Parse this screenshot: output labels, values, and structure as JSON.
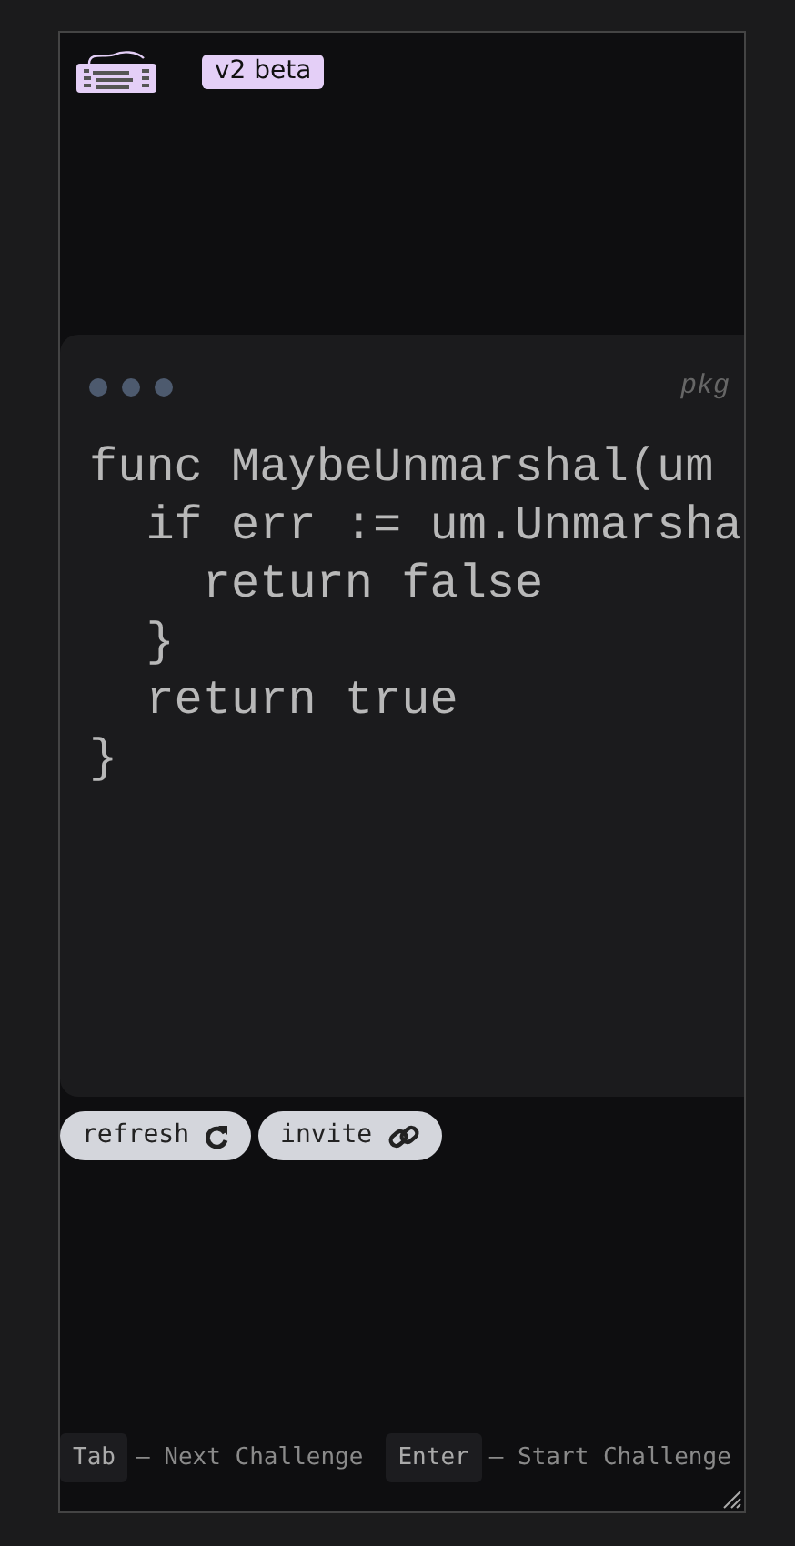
{
  "header": {
    "badge": "v2 beta"
  },
  "code_window": {
    "file_path": "pkg",
    "lines": [
      {
        "text": "func MaybeUnmarshal(um",
        "children": [
          {
            "text": "if err := um.Unmarsha",
            "children": [
              {
                "text": "return false"
              }
            ]
          },
          {
            "text": "}"
          },
          {
            "text": "return true"
          }
        ]
      },
      {
        "text": "}"
      }
    ]
  },
  "actions": [
    {
      "label": "refresh",
      "kind": "refresh"
    },
    {
      "label": "invite",
      "kind": "link"
    }
  ],
  "shortcuts": [
    {
      "key": "Tab",
      "description": "– Next Challenge"
    },
    {
      "key": "Enter",
      "description": "– Start Challenge"
    }
  ]
}
